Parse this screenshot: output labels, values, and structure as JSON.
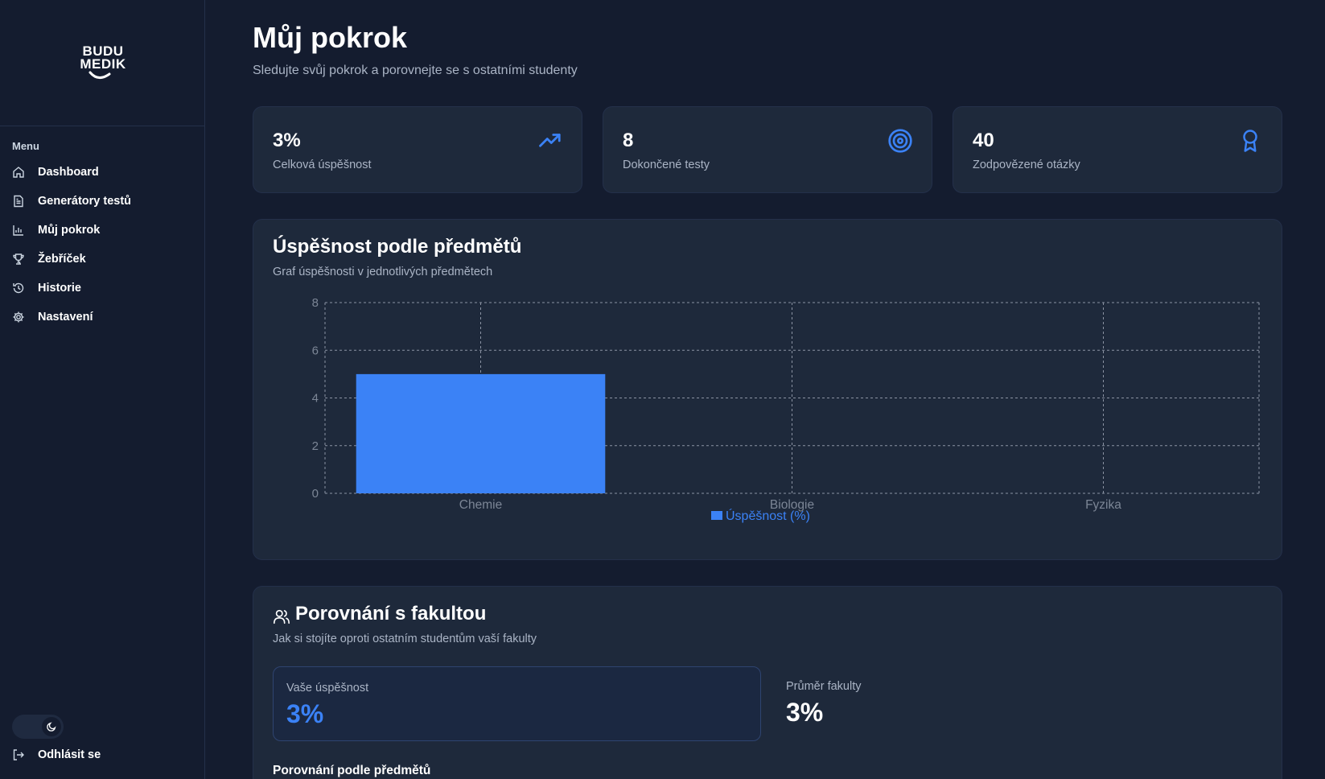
{
  "app": {
    "logo_line1": "BUDU",
    "logo_line2": "MEDIK"
  },
  "sidebar": {
    "menu_label": "Menu",
    "items": [
      {
        "label": "Dashboard",
        "icon": "home-icon"
      },
      {
        "label": "Generátory testů",
        "icon": "document-icon"
      },
      {
        "label": "Můj pokrok",
        "icon": "bar-chart-icon"
      },
      {
        "label": "Žebříček",
        "icon": "trophy-icon"
      },
      {
        "label": "Historie",
        "icon": "history-icon"
      },
      {
        "label": "Nastavení",
        "icon": "gear-icon"
      }
    ],
    "theme_toggle_icon": "moon-icon",
    "logout_label": "Odhlásit se"
  },
  "page": {
    "title": "Můj pokrok",
    "subtitle": "Sledujte svůj pokrok a porovnejte se s ostatními studenty"
  },
  "stats": [
    {
      "value": "3%",
      "label": "Celková úspěšnost",
      "icon": "trending-up-icon"
    },
    {
      "value": "8",
      "label": "Dokončené testy",
      "icon": "target-icon"
    },
    {
      "value": "40",
      "label": "Zodpovězené otázky",
      "icon": "award-icon"
    }
  ],
  "subject_panel": {
    "title": "Úspěšnost podle předmětů",
    "subtitle": "Graf úspěšnosti v jednotlivých předmětech"
  },
  "chart_data": {
    "type": "bar",
    "categories": [
      "Chemie",
      "Biologie",
      "Fyzika"
    ],
    "series": [
      {
        "name": "Úspěšnost (%)",
        "values": [
          5,
          0,
          0
        ]
      }
    ],
    "ylim": [
      0,
      8
    ],
    "yticks": [
      0,
      2,
      4,
      6,
      8
    ],
    "grid": true,
    "legend": "bottom-center",
    "color": "#3b82f6"
  },
  "compare_panel": {
    "title": "Porovnání s fakultou",
    "subtitle": "Jak si stojíte oproti ostatním studentům vaší fakulty",
    "your_label": "Vaše úspěšnost",
    "your_value": "3%",
    "faculty_label": "Průměr fakulty",
    "faculty_value": "3%",
    "by_subject_label": "Porovnání podle předmětů",
    "icon": "users-icon"
  },
  "colors": {
    "accent": "#3b82f6",
    "background": "#141c2f",
    "card": "#1e293b"
  }
}
